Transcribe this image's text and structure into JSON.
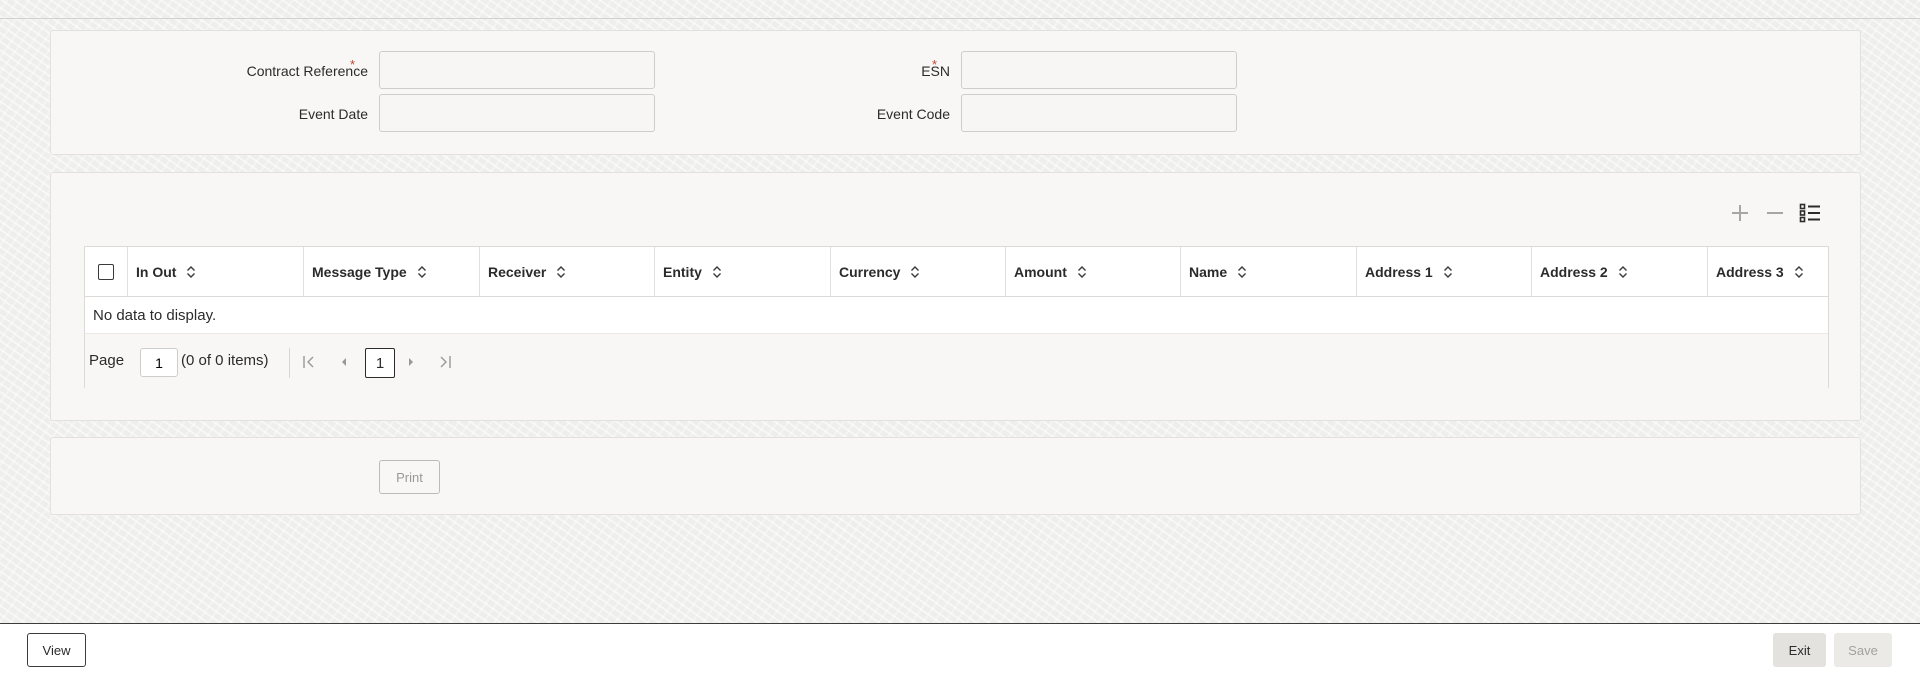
{
  "form": {
    "contract_reference_label": "Contract Reference",
    "esn_label": "ESN",
    "event_date_label": "Event Date",
    "event_code_label": "Event Code",
    "required_marker": "*",
    "contract_reference_value": "",
    "esn_value": "",
    "event_date_value": "",
    "event_code_value": ""
  },
  "grid": {
    "toolbar_icons": [
      "plus-icon",
      "minus-icon",
      "column-list-icon"
    ],
    "columns": [
      "In Out",
      "Message Type",
      "Receiver",
      "Entity",
      "Currency",
      "Amount",
      "Name",
      "Address 1",
      "Address 2",
      "Address 3"
    ],
    "empty_message": "No data to display.",
    "pager": {
      "page_label": "Page",
      "page_value": "1",
      "count_text": "(0 of 0 items)",
      "current_page": "1"
    }
  },
  "actions": {
    "print_label": "Print",
    "view_label": "View",
    "exit_label": "Exit",
    "save_label": "Save"
  },
  "colors": {
    "required": "#c74634",
    "background": "#eeeeec",
    "panel": "#f8f7f5"
  }
}
